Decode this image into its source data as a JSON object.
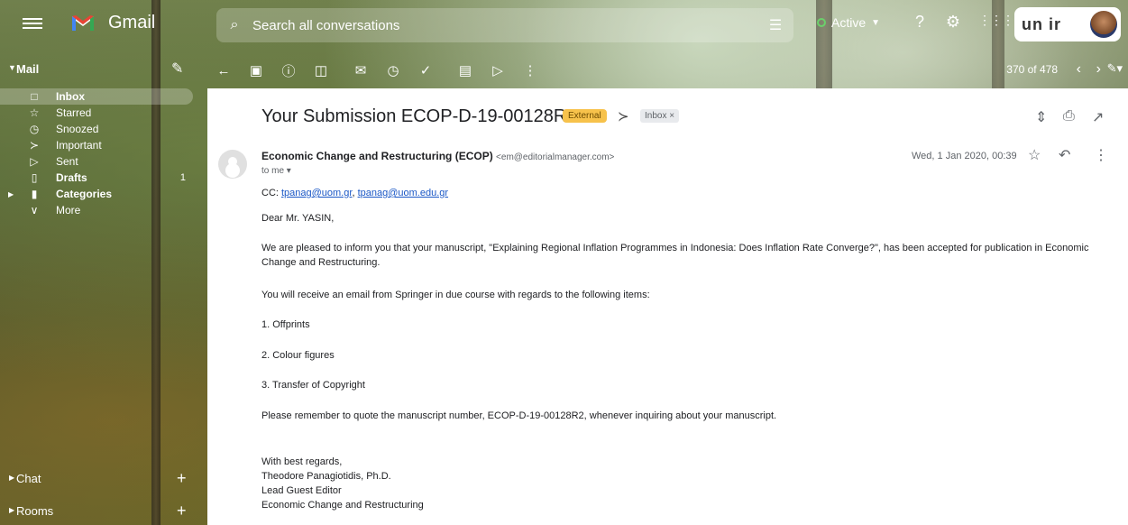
{
  "app": {
    "name": "Gmail"
  },
  "search": {
    "placeholder": "Search all conversations"
  },
  "status": {
    "label": "Active"
  },
  "account": {
    "org_label": "un ir"
  },
  "toolbar": {
    "count": "370 of 478"
  },
  "sidebar": {
    "mail_label": "Mail",
    "items": [
      {
        "label": "Inbox",
        "icon": "inbox-icon",
        "bold": true,
        "count": ""
      },
      {
        "label": "Starred",
        "icon": "star-icon",
        "bold": false,
        "count": ""
      },
      {
        "label": "Snoozed",
        "icon": "clock-icon",
        "bold": false,
        "count": ""
      },
      {
        "label": "Important",
        "icon": "important-icon",
        "bold": false,
        "count": ""
      },
      {
        "label": "Sent",
        "icon": "send-icon",
        "bold": false,
        "count": ""
      },
      {
        "label": "Drafts",
        "icon": "draft-icon",
        "bold": true,
        "count": "1"
      },
      {
        "label": "Categories",
        "icon": "label-icon",
        "bold": true,
        "count": ""
      },
      {
        "label": "More",
        "icon": "chevron-down-icon",
        "bold": false,
        "count": ""
      }
    ],
    "chat_label": "Chat",
    "rooms_label": "Rooms"
  },
  "email": {
    "subject": "Your Submission ECOP-D-19-00128R2",
    "badge_external": "External",
    "badge_inbox": "Inbox ×",
    "sender_name": "Economic Change and Restructuring (ECOP)",
    "sender_addr": "<em@editorialmanager.com>",
    "to": "to me ▾",
    "date": "Wed, 1 Jan 2020, 00:39",
    "cc_label": "CC: ",
    "cc_1": "tpanag@uom.gr",
    "cc_sep": ", ",
    "cc_2": "tpanag@uom.edu.gr",
    "greeting": "Dear Mr. YASIN,",
    "para1": "We are pleased to inform you that your manuscript, \"Explaining Regional Inflation Programmes in Indonesia: Does Inflation Rate Converge?\", has been accepted for publication in Economic Change and Restructuring.",
    "para2": "You will receive an email from Springer in due course with regards to the following items:",
    "item1": "1. Offprints",
    "item2": "2. Colour figures",
    "item3": "3. Transfer of Copyright",
    "para3": "Please remember to quote the manuscript number, ECOP-D-19-00128R2, whenever inquiring about your manuscript.",
    "sig1": "With best regards,",
    "sig2": "Theodore Panagiotidis, Ph.D.",
    "sig3": "Lead Guest Editor",
    "sig4": "Economic Change and Restructuring"
  }
}
